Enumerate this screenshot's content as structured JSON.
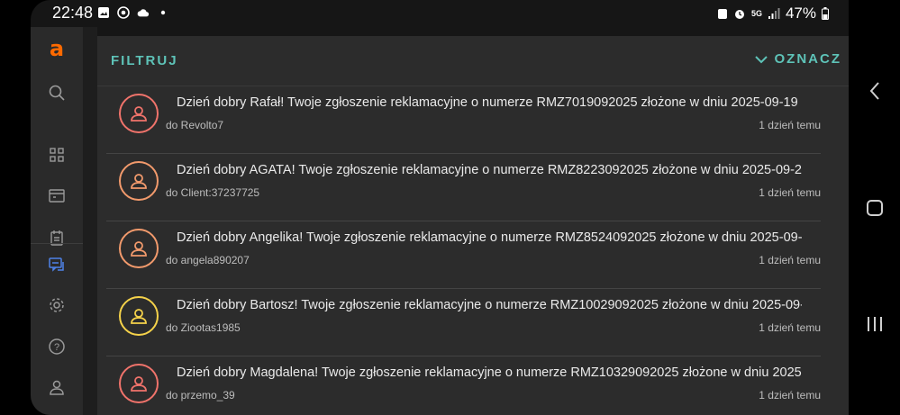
{
  "status_bar": {
    "time": "22:48",
    "network": "5G",
    "battery": "47%"
  },
  "sidebar": {
    "logo": "a",
    "items": [
      {
        "icon": "search-icon"
      },
      {
        "icon": "dashboard-icon"
      },
      {
        "icon": "shop-icon"
      },
      {
        "icon": "clipboard-icon"
      },
      {
        "icon": "messages-icon",
        "active": true
      },
      {
        "icon": "gear-icon"
      },
      {
        "icon": "help-icon"
      },
      {
        "icon": "user-icon"
      }
    ]
  },
  "toolbar": {
    "filter_label": "FILTRUJ",
    "mark_label": "OZNACZ"
  },
  "messages": [
    {
      "subject": "Dzień dobry Rafał! Twoje zgłoszenie reklamacyjne o numerze RMZ7019092025 złożone w dniu 2025-09-19 ...",
      "recipient": "do Revolto7",
      "time": "1 dzień temu",
      "avatar_color": "#f0736b"
    },
    {
      "subject": "Dzień dobry AGATA! Twoje zgłoszenie reklamacyjne o numerze RMZ8223092025 złożone w dniu 2025-09-2...",
      "recipient": "do Client:37237725",
      "time": "1 dzień temu",
      "avatar_color": "#f29a6c"
    },
    {
      "subject": "Dzień dobry Angelika! Twoje zgłoszenie reklamacyjne o numerze RMZ8524092025 złożone w dniu 2025-09-...",
      "recipient": "do angela890207",
      "time": "1 dzień temu",
      "avatar_color": "#f29a6c"
    },
    {
      "subject": "Dzień dobry Bartosz! Twoje zgłoszenie reklamacyjne o numerze RMZ10029092025 złożone w dniu 2025-09-...",
      "recipient": "do Ziootas1985",
      "time": "1 dzień temu",
      "avatar_color": "#f5d24a"
    },
    {
      "subject": "Dzień dobry Magdalena! Twoje zgłoszenie reklamacyjne o numerze RMZ10329092025 złożone w dniu 2025...",
      "recipient": "do przemo_39",
      "time": "1 dzień temu",
      "avatar_color": "#f0736b"
    }
  ],
  "colors": {
    "accent": "#5ec3b8",
    "brand": "#ff6a00",
    "active_icon": "#4e82e8"
  }
}
